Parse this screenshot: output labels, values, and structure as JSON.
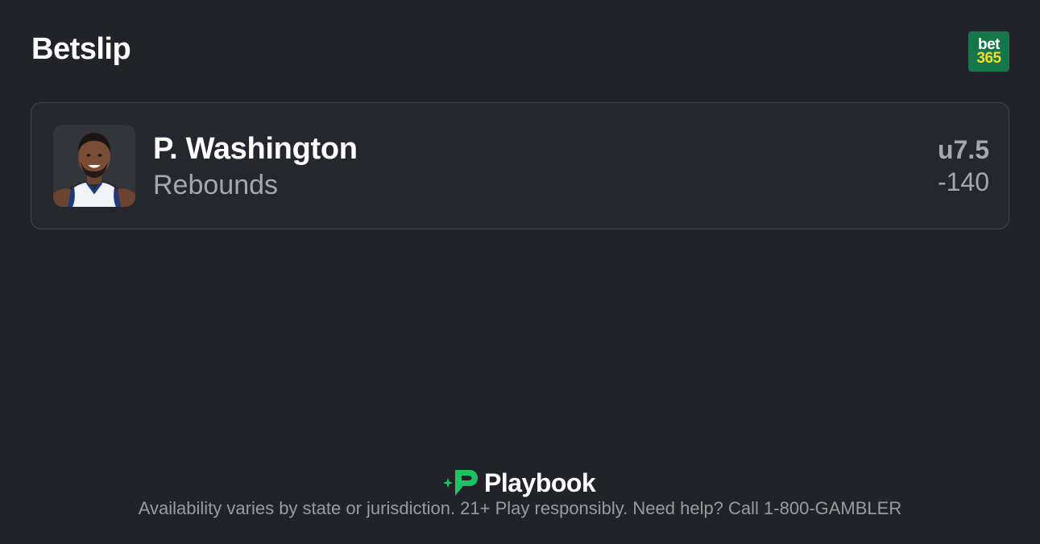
{
  "header": {
    "title": "Betslip",
    "sportsbook": {
      "line1": "bet",
      "line2": "365",
      "bg_color": "#14774a",
      "accent_color": "#f5dc2d"
    }
  },
  "bet": {
    "player_name": "P. Washington",
    "market": "Rebounds",
    "line": "u7.5",
    "odds": "-140",
    "avatar_icon": "player-headshot"
  },
  "footer": {
    "brand": "Playbook",
    "brand_color": "#19c463",
    "disclaimer": "Availability varies by state or jurisdiction. 21+ Play responsibly. Need help? Call 1-800-GAMBLER"
  },
  "colors": {
    "background": "#22222a",
    "card_border": "#44444c",
    "muted_text": "#a6a6ad"
  }
}
